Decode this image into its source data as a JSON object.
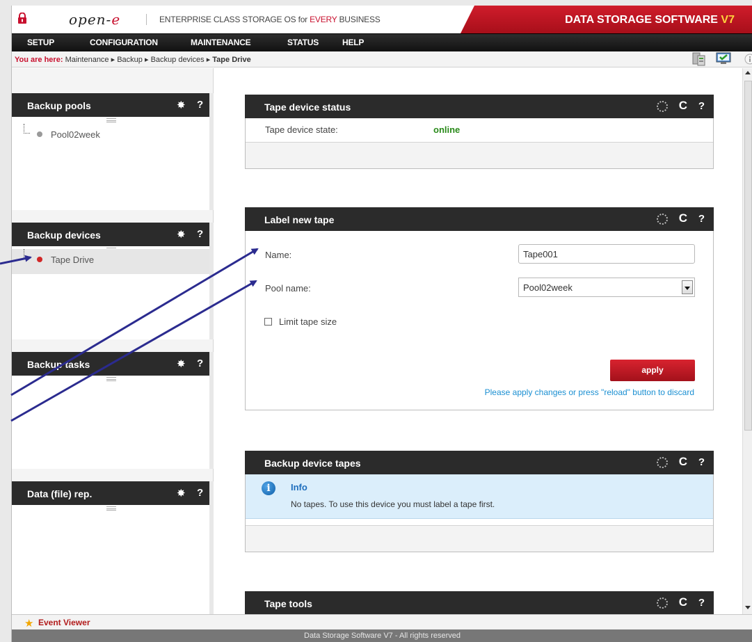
{
  "header": {
    "logo_main": "open-",
    "logo_accent": "e",
    "tagline_pre": "ENTERPRISE CLASS STORAGE OS for ",
    "tagline_accent": "EVERY",
    "tagline_post": " BUSINESS",
    "brand": "DATA STORAGE SOFTWARE ",
    "brand_version": "V7"
  },
  "menu": [
    "SETUP",
    "CONFIGURATION",
    "MAINTENANCE",
    "STATUS",
    "HELP"
  ],
  "breadcrumb": {
    "label": "You are here:",
    "items": [
      "Maintenance",
      "Backup",
      "Backup devices"
    ],
    "current": "Tape Drive",
    "separator": "▸"
  },
  "left_panels": [
    {
      "title": "Backup pools",
      "items": [
        {
          "label": "Pool02week",
          "dot_color": "#9a9a9a"
        }
      ]
    },
    {
      "title": "Backup devices",
      "items": [
        {
          "label": "Tape Drive",
          "dot_color": "#d12727"
        }
      ]
    },
    {
      "title": "Backup tasks",
      "items": []
    },
    {
      "title": "Data (file) rep.",
      "items": []
    }
  ],
  "tape_status": {
    "title": "Tape device status",
    "state_label": "Tape device state:",
    "state_value": "online",
    "state_color": "#2a8a1a"
  },
  "label_tape": {
    "title": "Label new tape",
    "name_label": "Name:",
    "name_value": "Tape001",
    "pool_label": "Pool name:",
    "pool_value": "Pool02week",
    "limit_label": "Limit tape size",
    "limit_checked": false,
    "apply_label": "apply",
    "hint": "Please apply changes or press \"reload\" button to discard"
  },
  "device_tapes": {
    "title": "Backup device tapes",
    "info_title": "Info",
    "info_text": "No tapes. To use this device you must label a tape first."
  },
  "tape_tools": {
    "title": "Tape tools"
  },
  "status_bar": {
    "event_viewer": "Event Viewer"
  },
  "footer": "Data Storage Software V7 - All rights reserved",
  "colors": {
    "accent_red": "#c8102e",
    "annotation_arrow": "#2b2b8f",
    "info_blue": "#1e6ebd"
  }
}
